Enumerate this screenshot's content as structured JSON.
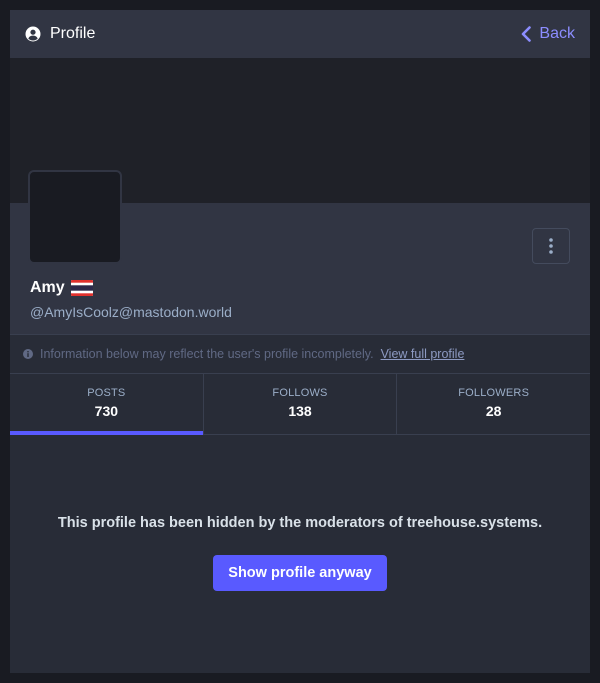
{
  "header": {
    "title": "Profile",
    "back_label": "Back",
    "user_icon": "user-circle-icon",
    "back_icon": "chevron-left-icon"
  },
  "profile": {
    "display_name": "Amy",
    "flag": "thailand-flag",
    "acct": "@AmyIsCoolz@mastodon.world",
    "menu_icon": "ellipsis-vertical-icon"
  },
  "notice": {
    "text": "Information below may reflect the user's profile incompletely.",
    "link": "View full profile",
    "icon": "info-circle-icon"
  },
  "counters": [
    {
      "label": "POSTS",
      "value": "730",
      "active": true
    },
    {
      "label": "FOLLOWS",
      "value": "138",
      "active": false
    },
    {
      "label": "FOLLOWERS",
      "value": "28",
      "active": false
    }
  ],
  "hidden": {
    "message": "This profile has been hidden by the moderators of treehouse.systems.",
    "button_label": "Show profile anyway"
  },
  "colors": {
    "accent": "#595aff",
    "link": "#8c8dff",
    "background": "#191b22",
    "panel": "#282c37",
    "header": "#313543"
  }
}
